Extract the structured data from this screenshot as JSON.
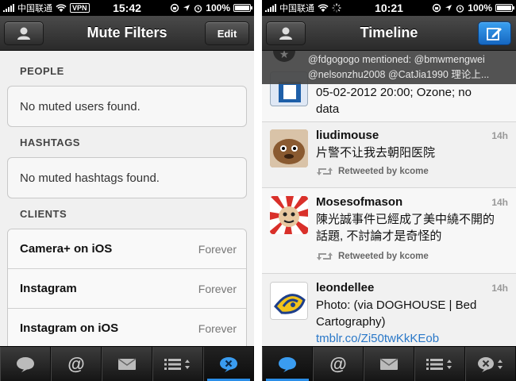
{
  "left": {
    "status": {
      "carrier": "中国联通",
      "vpn": "VPN",
      "time": "15:42",
      "battery": "100%"
    },
    "nav": {
      "title": "Mute Filters",
      "edit_label": "Edit"
    },
    "sections": {
      "people": {
        "header": "PEOPLE",
        "empty": "No muted users found."
      },
      "hashtags": {
        "header": "HASHTAGS",
        "empty": "No muted hashtags found."
      },
      "clients": {
        "header": "CLIENTS",
        "items": [
          {
            "name": "Camera+ on iOS",
            "duration": "Forever"
          },
          {
            "name": "Instagram",
            "duration": "Forever"
          },
          {
            "name": "Instagram on iOS",
            "duration": "Forever"
          }
        ]
      }
    },
    "tabs": [
      "timeline",
      "mentions",
      "messages",
      "lists",
      "mute"
    ]
  },
  "right": {
    "status": {
      "carrier": "中国联通",
      "time": "10:21",
      "battery": "100%"
    },
    "nav": {
      "title": "Timeline"
    },
    "banner": {
      "line1": "@fdgogogo mentioned: @bmwmengwei",
      "line2": "@nelsonzhu2008 @CatJia1990 理论上..."
    },
    "partial_tweet": {
      "line1": "05-02-2012 20:00; Ozone; no",
      "line2": "data"
    },
    "tweets": [
      {
        "name": "liudimouse",
        "time": "14h",
        "text": "片警不让我去朝阳医院",
        "retweeted_by": "Retweeted by kcome"
      },
      {
        "name": "Mosesofmason",
        "time": "14h",
        "text": "陳光誠事件已經成了美中繞不開的話題, 不討論才是奇怪的",
        "retweeted_by": "Retweeted by kcome"
      },
      {
        "name": "leondellee",
        "time": "14h",
        "text": "Photo: (via DOGHOUSE | Bed Cartography)",
        "link": "tmblr.co/Zi50twKkKEob"
      }
    ]
  },
  "colors": {
    "accent": "#2a8ee8",
    "link": "#2a78c8",
    "compose": "#1f7fd8"
  }
}
